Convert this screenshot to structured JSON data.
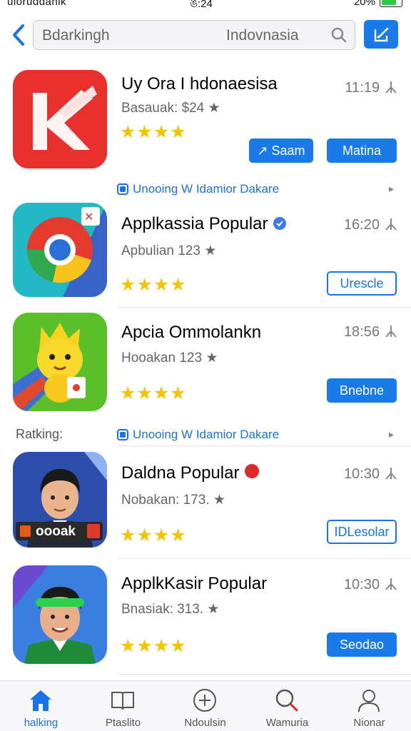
{
  "status_bar": {
    "left": "uioruddanlk",
    "center": "ঙ:24",
    "battery": "20%"
  },
  "search": {
    "query_left": "Bdarkingh",
    "query_right": "Indovnasia"
  },
  "apps": [
    {
      "title": "Uy Ora I hdonaesisa",
      "subtitle": "Basauak: $24 ★",
      "time": "11:19",
      "rating": "★★★★",
      "primary_button": "↗ Saam",
      "secondary_button": "Matina"
    },
    {
      "title": "Applkassia Popular",
      "subtitle": "Apbulian 123 ★",
      "time": "16:20",
      "rating": "★★★★",
      "outline_button": "Urescle"
    },
    {
      "title": "Apcia Ommolankn",
      "subtitle": "Hooakan 123 ★",
      "time": "18:56",
      "rating": "★★★★",
      "primary_button": "Bnebne"
    },
    {
      "title": "Daldna Popular",
      "subtitle": "Nobakan: 173. ★",
      "time": "10:30",
      "rating": "★★★★",
      "outline_button": "IDLesolar",
      "badge_text": "oooak"
    },
    {
      "title": "ApplkKasir Popular",
      "subtitle": "Bnasiak: 313. ★",
      "time": "10:30",
      "rating": "★★★★",
      "primary_button": "Seodao"
    }
  ],
  "section_links": [
    {
      "text": "Unooing W Idamior Dakare"
    },
    {
      "text": "Unooing W Idamior Dakare"
    }
  ],
  "ranking_label": "Ratking:",
  "tabs": [
    {
      "label": "halking",
      "icon": "home-icon",
      "active": true
    },
    {
      "label": "Ptaslito",
      "icon": "book-icon",
      "active": false
    },
    {
      "label": "Ndoulsin",
      "icon": "plus-circle-icon",
      "active": false
    },
    {
      "label": "Wamuria",
      "icon": "search-icon",
      "active": false
    },
    {
      "label": "Nionar",
      "icon": "person-icon",
      "active": false
    }
  ],
  "colors": {
    "accent": "#1a7ae8",
    "star": "#f5c400"
  }
}
